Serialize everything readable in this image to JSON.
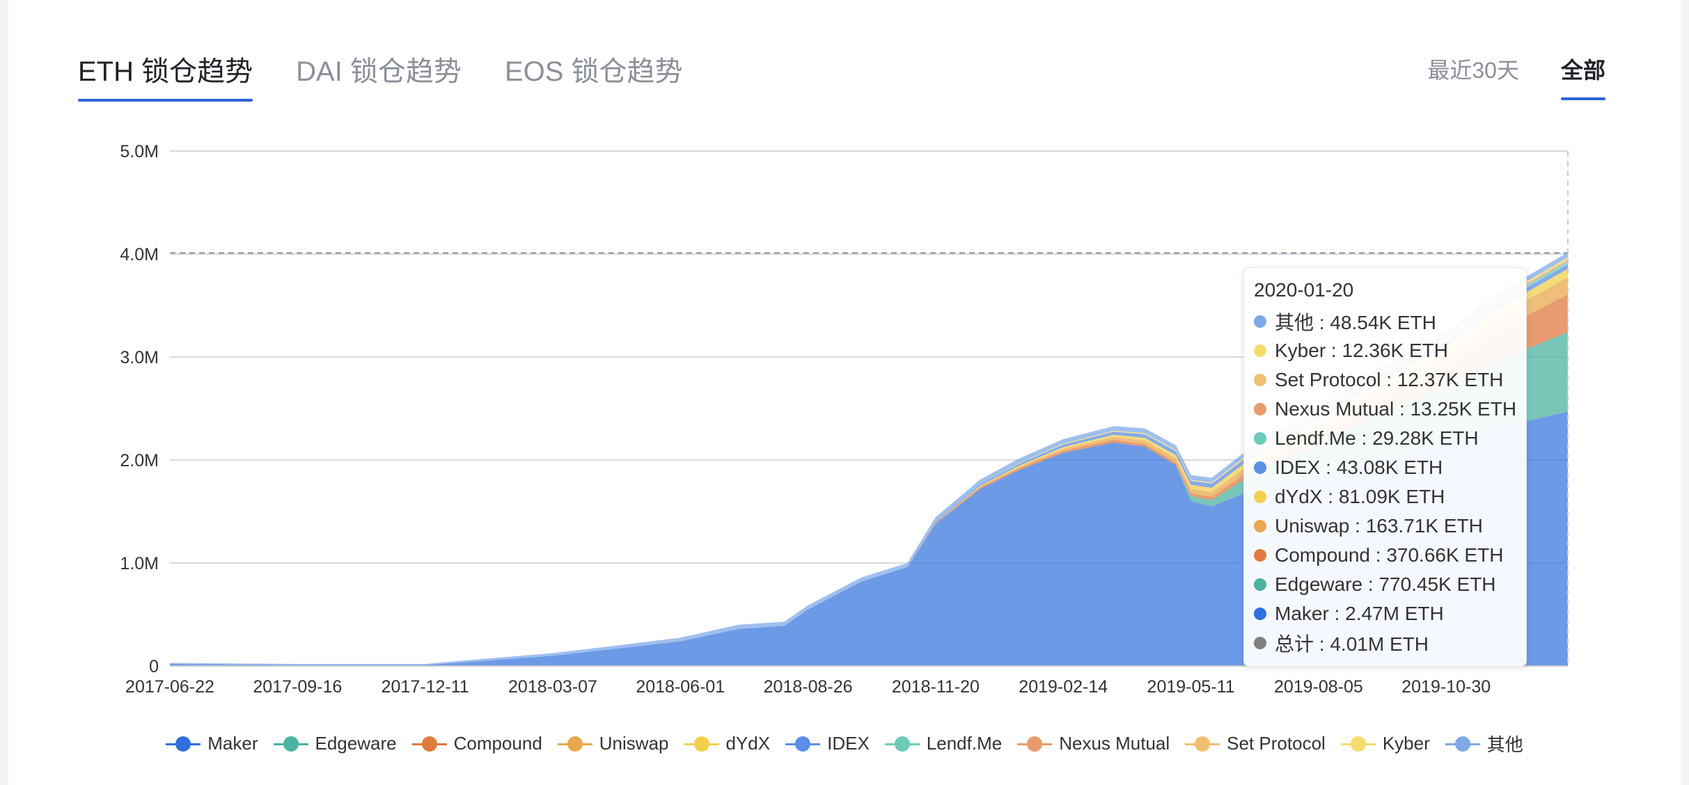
{
  "tabs": [
    {
      "label": "ETH 锁仓趋势",
      "active": true
    },
    {
      "label": "DAI 锁仓趋势",
      "active": false
    },
    {
      "label": "EOS 锁仓趋势",
      "active": false
    }
  ],
  "ranges": [
    {
      "label": "最近30天",
      "active": false
    },
    {
      "label": "全部",
      "active": true
    }
  ],
  "tooltip": {
    "date": "2020-01-20",
    "rows": [
      {
        "label": "其他 : 48.54K ETH",
        "color": "#7fa9e8"
      },
      {
        "label": "Kyber : 12.36K ETH",
        "color": "#f5dc6c"
      },
      {
        "label": "Set Protocol : 12.37K ETH",
        "color": "#f0c070"
      },
      {
        "label": "Nexus Mutual : 13.25K ETH",
        "color": "#e89a6c"
      },
      {
        "label": "Lendf.Me : 29.28K ETH",
        "color": "#6ccab8"
      },
      {
        "label": "IDEX : 43.08K ETH",
        "color": "#5b8ee6"
      },
      {
        "label": "dYdX : 81.09K ETH",
        "color": "#f3cf4e"
      },
      {
        "label": "Uniswap : 163.71K ETH",
        "color": "#e9a84e"
      },
      {
        "label": "Compound : 370.66K ETH",
        "color": "#e07a3e"
      },
      {
        "label": "Edgeware : 770.45K ETH",
        "color": "#4cb3a2"
      },
      {
        "label": "Maker : 2.47M ETH",
        "color": "#2f6fdb"
      },
      {
        "label": "总计 : 4.01M ETH",
        "color": "#808080"
      }
    ]
  },
  "chart_data": {
    "type": "area",
    "stacked": true,
    "y_tick_labels": [
      "0",
      "1.0M",
      "2.0M",
      "3.0M",
      "4.0M",
      "5.0M"
    ],
    "ylim": [
      0,
      5000000
    ],
    "x_tick_labels": [
      "2017-06-22",
      "2017-09-16",
      "2017-12-11",
      "2018-03-07",
      "2018-06-01",
      "2018-08-26",
      "2018-11-20",
      "2019-02-14",
      "2019-05-11",
      "2019-08-05",
      "2019-10-30"
    ],
    "x_range": [
      "2017-06-22",
      "2020-01-20"
    ],
    "grid": true,
    "legend_position": "bottom",
    "hover_date": "2020-01-20",
    "hover_total": 4010000,
    "x": [
      "2017-06-22",
      "2017-09-16",
      "2017-12-11",
      "2018-01-20",
      "2018-03-07",
      "2018-04-20",
      "2018-06-01",
      "2018-07-10",
      "2018-08-10",
      "2018-08-26",
      "2018-10-01",
      "2018-11-01",
      "2018-11-20",
      "2018-12-20",
      "2019-01-15",
      "2019-02-14",
      "2019-03-20",
      "2019-04-10",
      "2019-05-01",
      "2019-05-11",
      "2019-05-25",
      "2019-06-20",
      "2019-08-05",
      "2019-09-15",
      "2019-10-30",
      "2019-12-01",
      "2020-01-20"
    ],
    "series": [
      {
        "name": "Maker",
        "color": "#2f6fdb",
        "values": [
          20000,
          10000,
          10000,
          50000,
          100000,
          170000,
          240000,
          360000,
          390000,
          550000,
          820000,
          960000,
          1380000,
          1720000,
          1900000,
          2070000,
          2170000,
          2130000,
          1950000,
          1600000,
          1550000,
          1700000,
          1850000,
          2000000,
          2150000,
          2300000,
          2470000
        ]
      },
      {
        "name": "Edgeware",
        "color": "#4cb3a2",
        "values": [
          0,
          0,
          0,
          0,
          0,
          0,
          0,
          0,
          0,
          0,
          0,
          0,
          0,
          0,
          0,
          0,
          0,
          0,
          0,
          50000,
          60000,
          150000,
          300000,
          450000,
          550000,
          650000,
          770450
        ]
      },
      {
        "name": "Compound",
        "color": "#e07a3e",
        "values": [
          0,
          0,
          0,
          0,
          0,
          0,
          0,
          0,
          0,
          0,
          0,
          0,
          10000,
          15000,
          18000,
          20000,
          25000,
          25000,
          25000,
          28000,
          30000,
          50000,
          100000,
          150000,
          200000,
          280000,
          370660
        ]
      },
      {
        "name": "Uniswap",
        "color": "#e9a84e",
        "values": [
          0,
          0,
          0,
          0,
          0,
          0,
          0,
          0,
          0,
          0,
          0,
          0,
          0,
          10000,
          15000,
          20000,
          30000,
          35000,
          40000,
          45000,
          50000,
          60000,
          80000,
          100000,
          120000,
          140000,
          163710
        ]
      },
      {
        "name": "dYdX",
        "color": "#f3cf4e",
        "values": [
          0,
          0,
          0,
          0,
          0,
          0,
          0,
          0,
          0,
          0,
          0,
          0,
          0,
          5000,
          10000,
          15000,
          20000,
          25000,
          30000,
          35000,
          40000,
          50000,
          60000,
          70000,
          75000,
          78000,
          81090
        ]
      },
      {
        "name": "IDEX",
        "color": "#5b8ee6",
        "values": [
          0,
          0,
          0,
          0,
          0,
          0,
          0,
          0,
          0,
          0,
          0,
          0,
          10000,
          15000,
          20000,
          25000,
          30000,
          35000,
          40000,
          40000,
          40000,
          40000,
          40000,
          42000,
          42000,
          43000,
          43080
        ]
      },
      {
        "name": "Lendf.Me",
        "color": "#6ccab8",
        "values": [
          0,
          0,
          0,
          0,
          0,
          0,
          0,
          0,
          0,
          0,
          0,
          0,
          0,
          0,
          0,
          0,
          0,
          0,
          0,
          0,
          0,
          0,
          5000,
          10000,
          15000,
          20000,
          29280
        ]
      },
      {
        "name": "Nexus Mutual",
        "color": "#e89a6c",
        "values": [
          0,
          0,
          0,
          0,
          0,
          0,
          0,
          0,
          0,
          0,
          0,
          0,
          0,
          0,
          0,
          0,
          0,
          0,
          0,
          0,
          0,
          5000,
          8000,
          10000,
          11000,
          12000,
          13250
        ]
      },
      {
        "name": "Set Protocol",
        "color": "#f0c070",
        "values": [
          0,
          0,
          0,
          0,
          0,
          0,
          0,
          0,
          0,
          0,
          0,
          0,
          0,
          0,
          0,
          0,
          0,
          0,
          0,
          0,
          0,
          5000,
          8000,
          10000,
          11000,
          12000,
          12370
        ]
      },
      {
        "name": "Kyber",
        "color": "#f5dc6c",
        "values": [
          0,
          0,
          0,
          0,
          0,
          0,
          0,
          0,
          0,
          0,
          0,
          0,
          0,
          0,
          5000,
          8000,
          9000,
          10000,
          10000,
          10000,
          10000,
          11000,
          11000,
          12000,
          12000,
          12000,
          12360
        ]
      },
      {
        "name": "其他",
        "color": "#7fa9e8",
        "values": [
          10000,
          10000,
          10000,
          20000,
          25000,
          30000,
          35000,
          40000,
          40000,
          40000,
          40000,
          40000,
          45000,
          45000,
          45000,
          45000,
          46000,
          47000,
          47000,
          47000,
          47000,
          47000,
          48000,
          48000,
          48000,
          48500,
          48540
        ]
      }
    ]
  }
}
